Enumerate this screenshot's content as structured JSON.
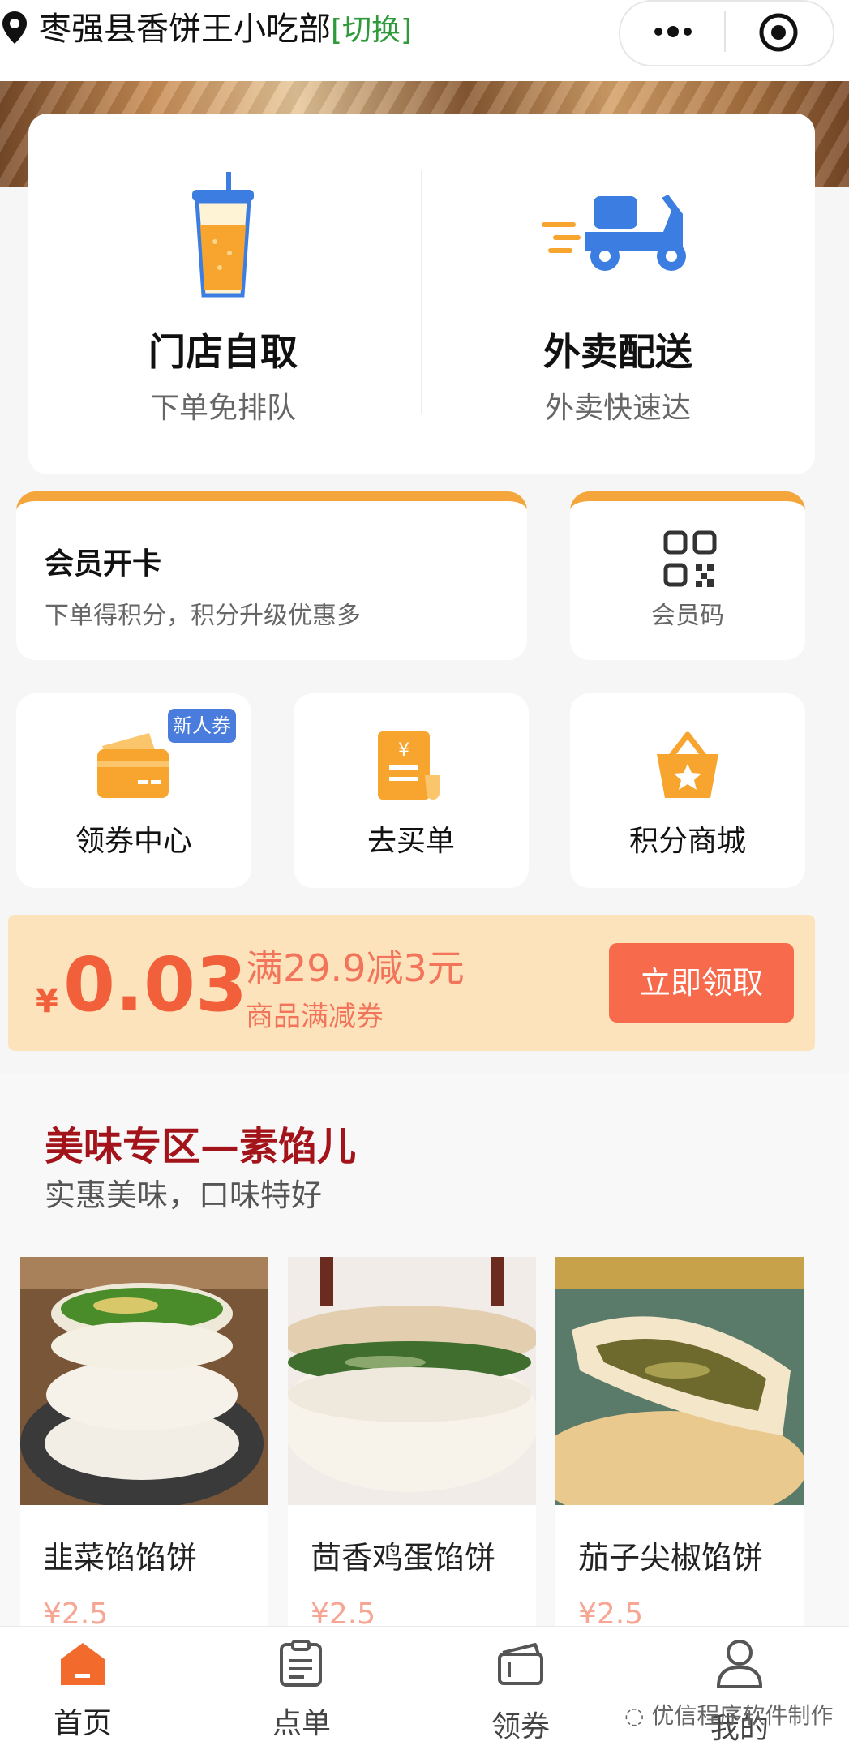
{
  "header": {
    "store_name": "枣强县香饼王小吃部",
    "switch_label": "[切换]"
  },
  "order_modes": [
    {
      "title": "门店自取",
      "subtitle": "下单免排队",
      "icon": "drink-cup-icon"
    },
    {
      "title": "外卖配送",
      "subtitle": "外卖快速达",
      "icon": "delivery-scooter-icon"
    }
  ],
  "member": {
    "title": "会员开卡",
    "subtitle": "下单得积分，积分升级优惠多",
    "code_label": "会员码"
  },
  "quick_actions": [
    {
      "label": "领券中心",
      "badge": "新人券",
      "icon": "coupon-card-icon"
    },
    {
      "label": "去买单",
      "icon": "bill-icon"
    },
    {
      "label": "积分商城",
      "icon": "star-basket-icon"
    }
  ],
  "coupon": {
    "currency": "¥",
    "amount": "0.03",
    "condition": "满29.9减3元",
    "type": "商品满减券",
    "button": "立即领取"
  },
  "section": {
    "title": "美味专区—素馅儿",
    "subtitle": "实惠美味，口味特好"
  },
  "products": [
    {
      "name": "韭菜馅馅饼",
      "price": "¥2.5"
    },
    {
      "name": "茴香鸡蛋馅饼",
      "price": "¥2.5"
    },
    {
      "name": "茄子尖椒馅饼",
      "price": "¥2.5"
    }
  ],
  "tabs": [
    {
      "label": "首页",
      "active": true
    },
    {
      "label": "点单"
    },
    {
      "label": "领券"
    },
    {
      "label": "我的"
    }
  ],
  "watermark": "优信程序软件制作",
  "colors": {
    "accent_orange": "#f4a63d",
    "coupon_red": "#f25f3b",
    "section_title": "#a3131a",
    "switch_green": "#2f9a3a",
    "badge_blue": "#4a7cdd"
  }
}
